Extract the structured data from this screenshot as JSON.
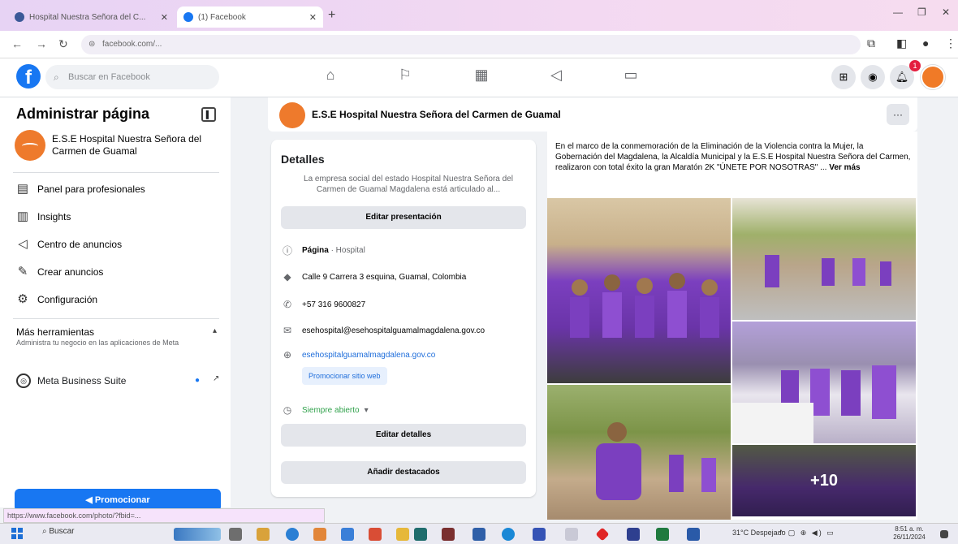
{
  "browser": {
    "tabs": [
      {
        "title": "Hospital Nuestra Señora del C...",
        "active": false
      },
      {
        "title": "(1) Facebook",
        "active": true
      }
    ],
    "new_tab": "+",
    "address": "facebook.com/..."
  },
  "fb": {
    "logo": "f",
    "search_placeholder": "Buscar en Facebook",
    "notification_count": "1"
  },
  "sidebar": {
    "title": "Administrar página",
    "page_name": "E.S.E Hospital Nuestra Señora del Carmen de Guamal",
    "items": [
      {
        "label": "Panel para profesionales",
        "icon": "dashboard-icon"
      },
      {
        "label": "Insights",
        "icon": "insights-icon"
      },
      {
        "label": "Centro de anuncios",
        "icon": "megaphone-icon"
      },
      {
        "label": "Crear anuncios",
        "icon": "edit-icon"
      },
      {
        "label": "Configuración",
        "icon": "gear-icon"
      }
    ],
    "more_tools": "Más herramientas",
    "more_tools_desc": "Administra tu negocio en las aplicaciones de Meta",
    "meta_suite": "Meta Business Suite",
    "promote": "Promocionar"
  },
  "status_url": "https://www.facebook.com/photo/?fbid=...",
  "page_header": {
    "name": "E.S.E Hospital Nuestra Señora del Carmen de Guamal",
    "more": "···"
  },
  "details": {
    "title": "Detalles",
    "description": "La empresa social del estado Hospital Nuestra Señora del Carmen de Guamal Magdalena está articulado al...",
    "edit_intro": "Editar presentación",
    "page_label": "Página",
    "page_category": "· Hospital",
    "address": "Calle 9 Carrera 3 esquina, Guamal, Colombia",
    "phone": "+57 316 9600827",
    "email": "esehospital@esehospitalguamalmagdalena.gov.co",
    "website": "esehospitalguamalmagdalena.gov.co",
    "promote_site": "Promocionar sitio web",
    "hours": "Siempre abierto",
    "edit_details": "Editar detalles",
    "add_featured": "Añadir destacados"
  },
  "post": {
    "text": "En el marco de la conmemoración de la Eliminación de la Violencia contra la Mujer, la Gobernación del Magdalena, la Alcaldía Municipal y la E.S.E Hospital Nuestra Señora del Carmen, realizaron con total éxito la gran Maratón 2K \"ÚNETE POR NOSOTRAS\" ...",
    "see_more": "Ver más",
    "more_photos": "+10"
  },
  "taskbar": {
    "search": "Buscar",
    "weather": "31°C Despejado",
    "time": "8:51 a. m.",
    "date": "26/11/2024"
  },
  "colors": {
    "facebook_blue": "#1877f2",
    "page_orange": "#ee7a2c",
    "event_purple": "#7b3fbf"
  }
}
